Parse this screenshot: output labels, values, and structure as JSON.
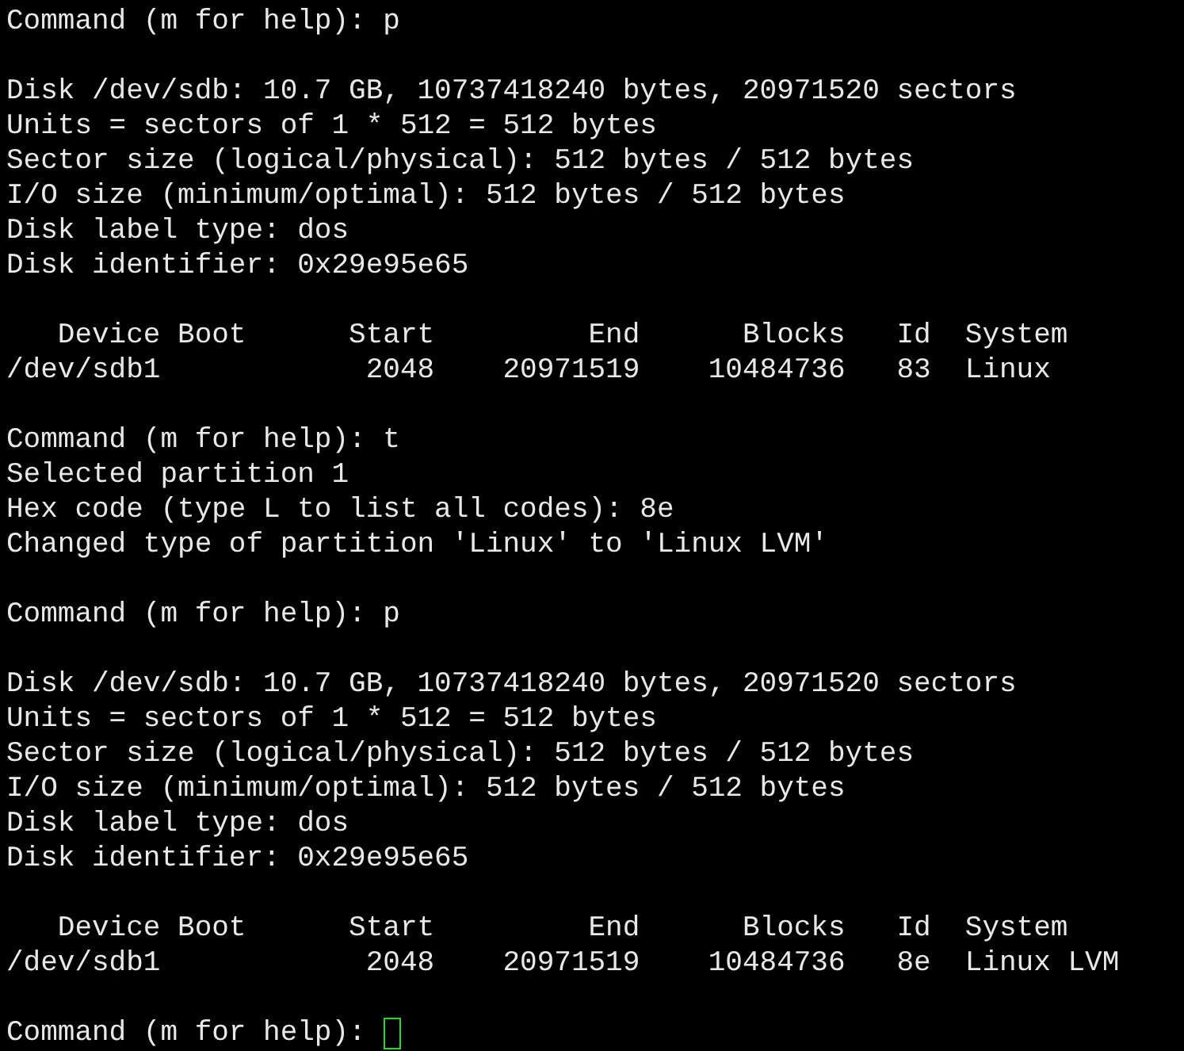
{
  "terminal": {
    "blocks": [
      {
        "lines": [
          {
            "text": "Command (m for help): p"
          }
        ]
      },
      {
        "lines": [
          {
            "text": "Disk /dev/sdb: 10.7 GB, 10737418240 bytes, 20971520 sectors"
          },
          {
            "text": "Units = sectors of 1 * 512 = 512 bytes"
          },
          {
            "text": "Sector size (logical/physical): 512 bytes / 512 bytes"
          },
          {
            "text": "I/O size (minimum/optimal): 512 bytes / 512 bytes"
          },
          {
            "text": "Disk label type: dos"
          },
          {
            "text": "Disk identifier: 0x29e95e65"
          }
        ]
      },
      {
        "lines": [
          {
            "text": "   Device Boot      Start         End      Blocks   Id  System"
          },
          {
            "text": "/dev/sdb1            2048    20971519    10484736   83  Linux"
          }
        ]
      },
      {
        "lines": [
          {
            "text": "Command (m for help): t"
          },
          {
            "text": "Selected partition 1"
          },
          {
            "text": "Hex code (type L to list all codes): 8e"
          },
          {
            "text": "Changed type of partition 'Linux' to 'Linux LVM'"
          }
        ]
      },
      {
        "lines": [
          {
            "text": "Command (m for help): p"
          }
        ]
      },
      {
        "lines": [
          {
            "text": "Disk /dev/sdb: 10.7 GB, 10737418240 bytes, 20971520 sectors"
          },
          {
            "text": "Units = sectors of 1 * 512 = 512 bytes"
          },
          {
            "text": "Sector size (logical/physical): 512 bytes / 512 bytes"
          },
          {
            "text": "I/O size (minimum/optimal): 512 bytes / 512 bytes"
          },
          {
            "text": "Disk label type: dos"
          },
          {
            "text": "Disk identifier: 0x29e95e65"
          }
        ]
      },
      {
        "lines": [
          {
            "text": "   Device Boot      Start         End      Blocks   Id  System"
          },
          {
            "text": "/dev/sdb1            2048    20971519    10484736   8e  Linux LVM"
          }
        ]
      },
      {
        "lines": [
          {
            "text": "Command (m for help): ",
            "cursor": true
          }
        ]
      }
    ]
  }
}
